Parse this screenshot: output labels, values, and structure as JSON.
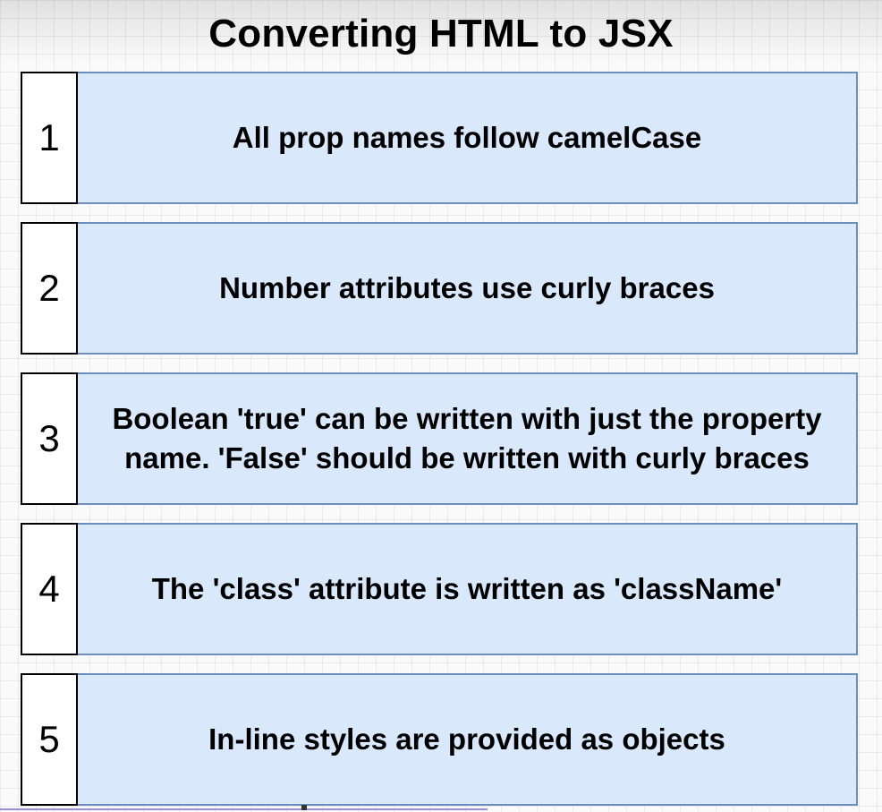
{
  "title": "Converting HTML to JSX",
  "rules": [
    {
      "number": "1",
      "text": "All prop names follow camelCase"
    },
    {
      "number": "2",
      "text": "Number attributes use curly braces"
    },
    {
      "number": "3",
      "text": "Boolean 'true' can be written with just the property name.  'False' should be written with curly braces"
    },
    {
      "number": "4",
      "text": "The 'class' attribute is written as 'className'"
    },
    {
      "number": "5",
      "text": "In-line styles are provided as objects"
    }
  ],
  "colors": {
    "box_fill": "#dae8fc",
    "box_border": "#6c8ebf",
    "number_border": "#000000"
  }
}
